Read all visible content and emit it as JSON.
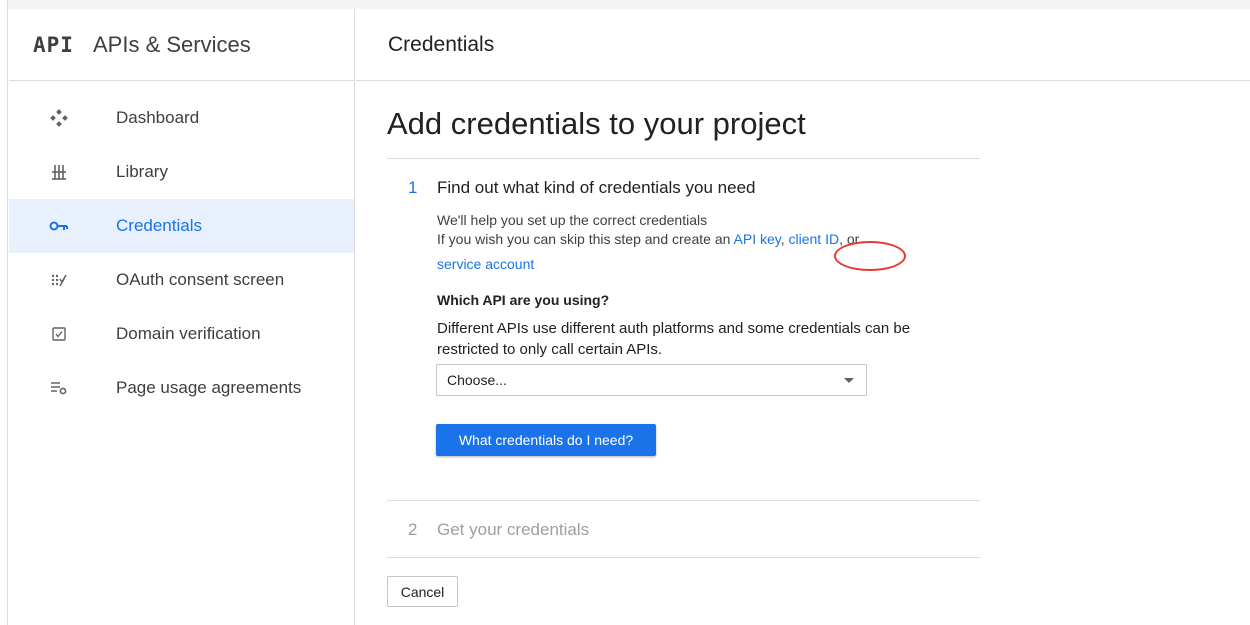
{
  "sidebar": {
    "logo": "API",
    "title": "APIs & Services",
    "items": [
      {
        "label": "Dashboard",
        "icon": "dashboard-icon"
      },
      {
        "label": "Library",
        "icon": "library-icon"
      },
      {
        "label": "Credentials",
        "icon": "key-icon",
        "active": true
      },
      {
        "label": "OAuth consent screen",
        "icon": "oauth-icon"
      },
      {
        "label": "Domain verification",
        "icon": "checkbox-icon"
      },
      {
        "label": "Page usage agreements",
        "icon": "settings-list-icon"
      }
    ]
  },
  "header": {
    "title": "Credentials"
  },
  "main": {
    "heading": "Add credentials to your project",
    "step1": {
      "number": "1",
      "title": "Find out what kind of credentials you need",
      "help_line1": "We'll help you set up the correct credentials",
      "help_line2_prefix": "If you wish you can skip this step and create an ",
      "link_api_key": "API key",
      "sep_comma": ", ",
      "link_client_id": "client ID",
      "sep_or": ", or",
      "link_service_account": "service account",
      "question": "Which API are you using?",
      "description": "Different APIs use different auth platforms and some credentials can be restricted to only call certain APIs.",
      "select_value": "Choose...",
      "button_label": "What credentials do I need?"
    },
    "step2": {
      "number": "2",
      "title": "Get your credentials"
    },
    "cancel_label": "Cancel"
  },
  "colors": {
    "accent": "#1a73e8",
    "active_bg": "#e8f0fe",
    "annotation": "#e53935"
  }
}
